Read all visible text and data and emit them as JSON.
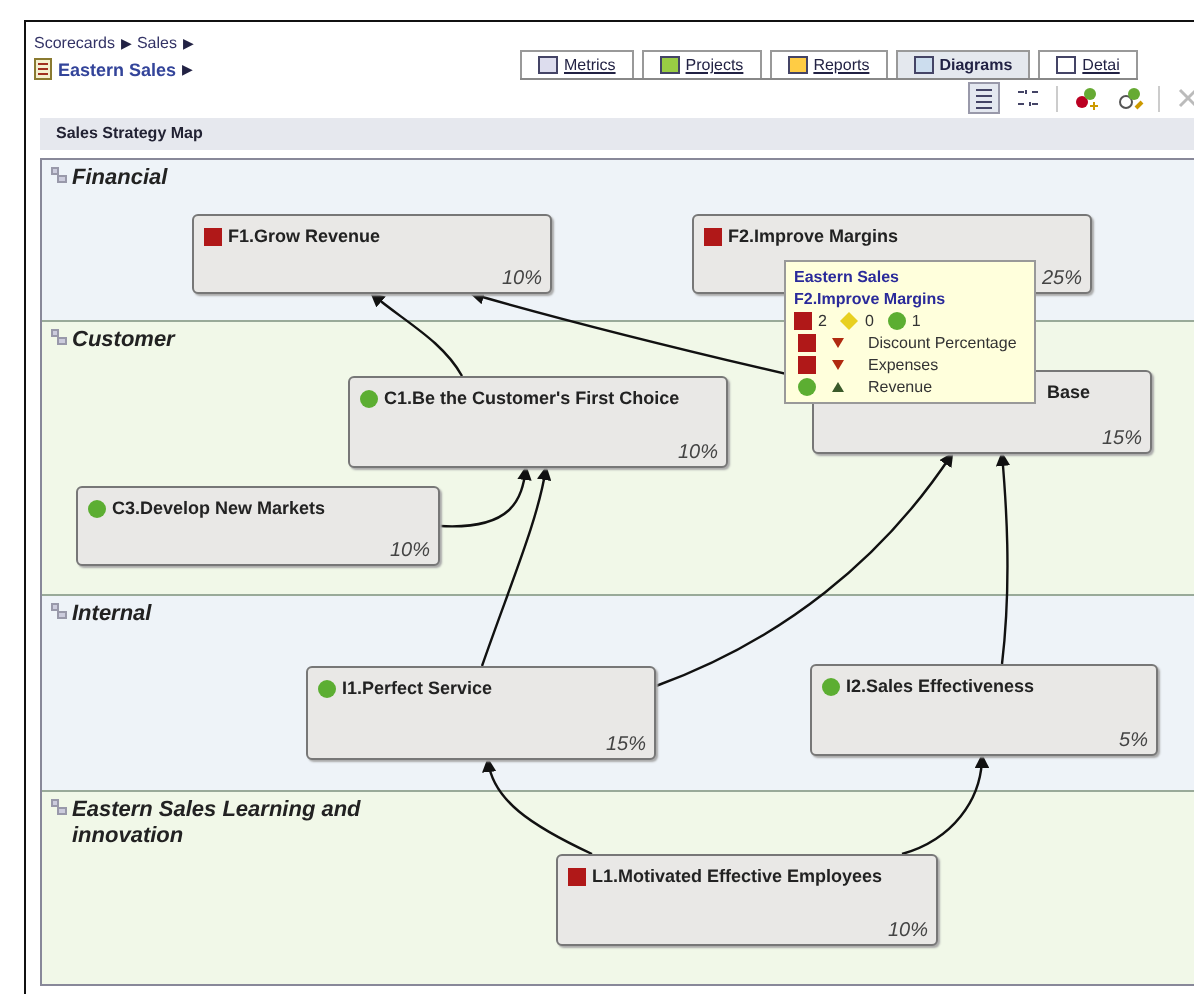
{
  "breadcrumb": {
    "path": [
      {
        "label": "Scorecards"
      },
      {
        "label": "Sales"
      }
    ],
    "separator": "▶",
    "current": "Eastern Sales"
  },
  "tabs": [
    {
      "label": "Metrics",
      "selected": false
    },
    {
      "label": "Projects",
      "selected": false
    },
    {
      "label": "Reports",
      "selected": false
    },
    {
      "label": "Diagrams",
      "selected": true
    },
    {
      "label": "Detai",
      "selected": false
    }
  ],
  "map": {
    "title": "Sales Strategy Map",
    "lanes": [
      {
        "title": "Financial",
        "color": "#eef3f8"
      },
      {
        "title": "Customer",
        "color": "#f1f8e8"
      },
      {
        "title": "Internal",
        "color": "#eef3f8"
      },
      {
        "title": "Eastern Sales Learning and innovation",
        "color": "#f1f8e8"
      }
    ],
    "nodes": [
      {
        "title": "F1.Grow Revenue",
        "status": {
          "kind": "square",
          "color": "#b01818"
        },
        "weight": "10%"
      },
      {
        "title": "F2.Improve Margins",
        "status": {
          "kind": "square",
          "color": "#b01818"
        },
        "weight": "25%"
      },
      {
        "title": "C1.Be the Customer's First Choice",
        "status": {
          "kind": "circle",
          "color": "#5cae32"
        },
        "weight": "10%"
      },
      {
        "title": "Base",
        "weight": "15%"
      },
      {
        "title": "C3.Develop New Markets",
        "status": {
          "kind": "circle",
          "color": "#5cae32"
        },
        "weight": "10%"
      },
      {
        "title": "I1.Perfect Service",
        "status": {
          "kind": "circle",
          "color": "#5cae32"
        },
        "weight": "15%"
      },
      {
        "title": "I2.Sales Effectiveness",
        "status": {
          "kind": "circle",
          "color": "#5cae32"
        },
        "weight": "5%"
      },
      {
        "title": "L1.Motivated Effective Employees",
        "status": {
          "kind": "square",
          "color": "#b01818"
        },
        "weight": "10%"
      }
    ],
    "tooltip": {
      "scorecard": "Eastern Sales",
      "objective": "F2.Improve Margins",
      "counts": [
        {
          "kind": "square",
          "color": "#b01818",
          "count": "2"
        },
        {
          "kind": "diamond",
          "color": "#e8d020",
          "count": "0"
        },
        {
          "kind": "circle",
          "color": "#5cae32",
          "count": "1"
        }
      ],
      "metrics": [
        {
          "status": {
            "kind": "square",
            "color": "#b01818"
          },
          "trend": {
            "kind": "down"
          },
          "name": "Discount Percentage"
        },
        {
          "status": {
            "kind": "square",
            "color": "#b01818"
          },
          "trend": {
            "kind": "down"
          },
          "name": "Expenses"
        },
        {
          "status": {
            "kind": "circle",
            "color": "#5cae32"
          },
          "trend": {
            "kind": "up"
          },
          "name": "Revenue"
        }
      ]
    }
  }
}
